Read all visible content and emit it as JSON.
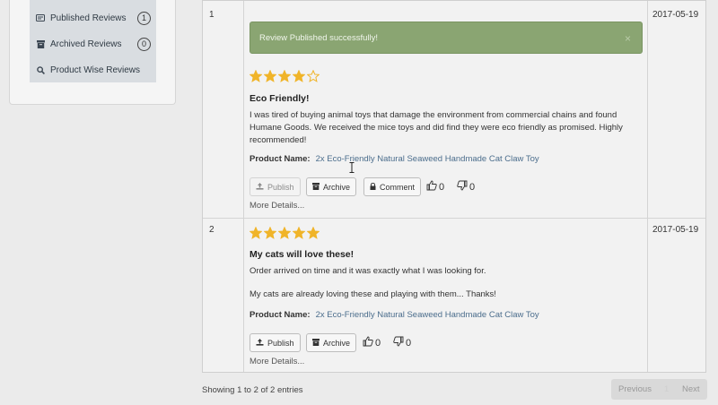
{
  "sidebar": {
    "items": [
      {
        "label": "Published Reviews",
        "icon": "published-icon",
        "count": "1"
      },
      {
        "label": "Archived Reviews",
        "icon": "archive-icon",
        "count": "0"
      },
      {
        "label": "Product Wise Reviews",
        "icon": "search-icon"
      }
    ]
  },
  "reviews": [
    {
      "index": "1",
      "date": "2017-05-19",
      "alert": "Review Published successfully!",
      "alert_close": "×",
      "rating": 4,
      "title": "Eco Friendly!",
      "body": "I was tired of buying animal toys that damage the environment from commercial chains and found Humane Goods. We received the mice toys and did find they were eco friendly as promised. Highly recommended!",
      "product_label": "Product Name:",
      "product_name": "2x Eco-Friendly Natural Seaweed Handmade Cat Claw Toy",
      "buttons": {
        "publish": "Publish",
        "archive": "Archive",
        "comment": "Comment"
      },
      "likes": "0",
      "dislikes": "0",
      "more": "More Details..."
    },
    {
      "index": "2",
      "date": "2017-05-19",
      "rating": 5,
      "title": "My cats will love these!",
      "body_1": "Order arrived on time and it was exactly what I was looking for.",
      "body_2": "My cats are already loving these and playing with them... Thanks!",
      "product_label": "Product Name:",
      "product_name": "2x Eco-Friendly Natural Seaweed Handmade Cat Claw Toy",
      "buttons": {
        "publish": "Publish",
        "archive": "Archive"
      },
      "likes": "0",
      "dislikes": "0",
      "more": "More Details..."
    }
  ],
  "footer": {
    "showing": "Showing 1 to 2 of 2 entries",
    "previous": "Previous",
    "page": "1",
    "next": "Next"
  },
  "colors": {
    "star": "#f0b429",
    "alert_bg": "#8aa572",
    "link": "#4b6d8c"
  }
}
